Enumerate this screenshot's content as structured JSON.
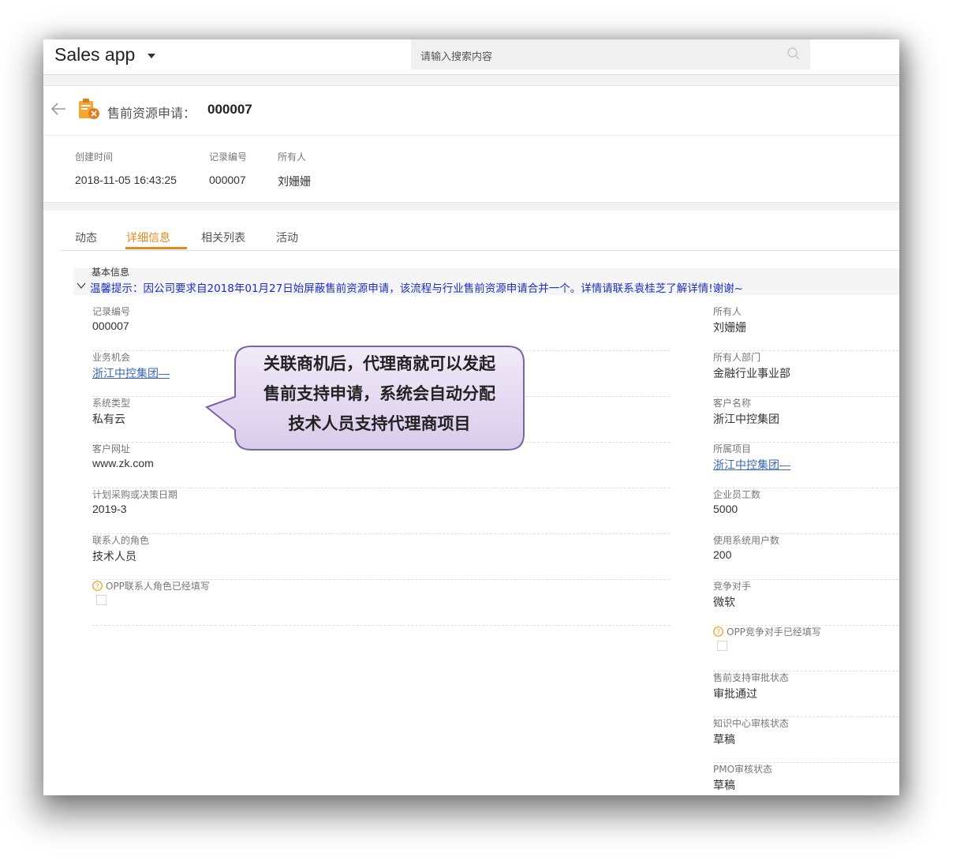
{
  "app": {
    "title": "Sales app"
  },
  "search": {
    "placeholder": "请输入搜索内容"
  },
  "record": {
    "type_label": "售前资源申请：",
    "number": "000007"
  },
  "meta": [
    {
      "label": "创建时间",
      "value": "2018-11-05 16:43:25"
    },
    {
      "label": "记录编号",
      "value": "000007"
    },
    {
      "label": "所有人",
      "value": "刘姗姗"
    }
  ],
  "tabs": [
    "动态",
    "详细信息",
    "相关列表",
    "活动"
  ],
  "active_tab": "详细信息",
  "section": {
    "title": "基本信息",
    "notice": "温馨提示：因公司要求自2018年01月27日始屏蔽售前资源申请，该流程与行业售前资源申请合并一个。详情请联系袁桂芝了解详情!谢谢~"
  },
  "left_fields": [
    {
      "label": "记录编号",
      "value": "000007"
    },
    {
      "label": "业务机会",
      "value": "浙江中控集团—"
    },
    {
      "label": "系统类型",
      "value": "私有云"
    },
    {
      "label": "客户网址",
      "value": "www.zk.com"
    },
    {
      "label": "计划采购或决策日期",
      "value": "2019-3"
    },
    {
      "label": "联系人的角色",
      "value": "技术人员"
    },
    {
      "label": "OPP联系人角色已经填写",
      "value": ""
    }
  ],
  "right_fields": [
    {
      "label": "所有人",
      "value": "刘姗姗"
    },
    {
      "label": "所有人部门",
      "value": "金融行业事业部"
    },
    {
      "label": "客户名称",
      "value": "浙江中控集团"
    },
    {
      "label": "所属项目",
      "value": "浙江中控集团—"
    },
    {
      "label": "企业员工数",
      "value": "5000"
    },
    {
      "label": "使用系统用户数",
      "value": "200"
    },
    {
      "label": "竞争对手",
      "value": "微软"
    },
    {
      "label": "OPP竞争对手已经填写",
      "value": ""
    },
    {
      "label": "售前支持审批状态",
      "value": "审批通过"
    },
    {
      "label": "知识中心审核状态",
      "value": "草稿"
    },
    {
      "label": "PMO审核状态",
      "value": "草稿"
    }
  ],
  "callout": {
    "line1": "关联商机后，代理商就可以发起",
    "line2": "售前支持申请，系统会自动分配",
    "line3": "技术人员支持代理商项目"
  },
  "colors": {
    "accent": "#e8891d",
    "notice": "#1a2ecc",
    "link": "#3a66b5",
    "callout_fill": "#e2d6f0",
    "callout_border": "#7b63a8"
  },
  "icons": {
    "search": "search-icon",
    "back": "arrow-left-icon",
    "record": "clipboard-icon",
    "help": "question-circle-icon",
    "collapse": "chevron-down-icon"
  }
}
